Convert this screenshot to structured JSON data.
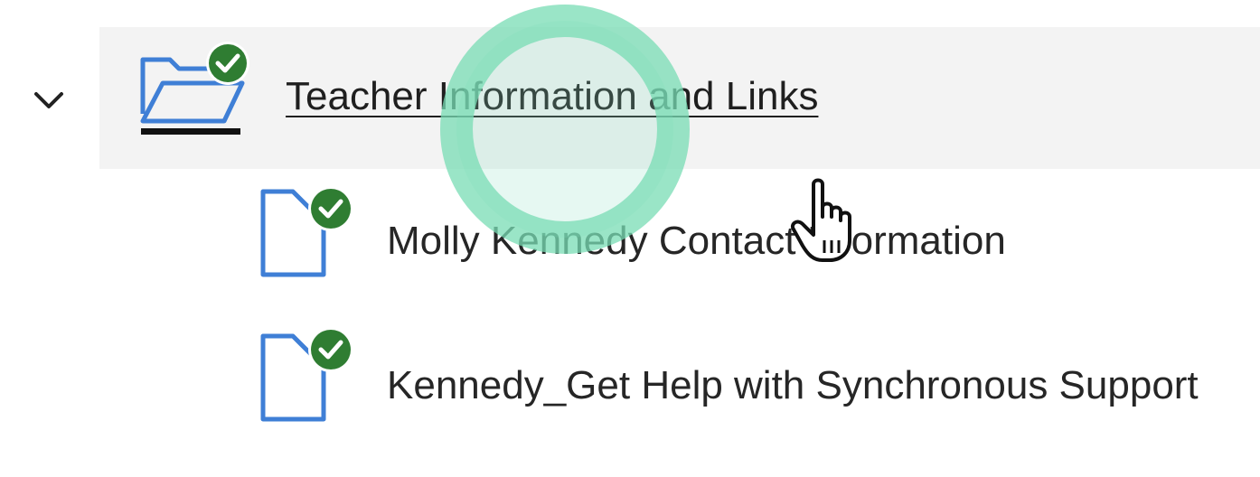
{
  "tree": {
    "folder": {
      "label": "Teacher Information and Links",
      "icon": "folder-open-icon",
      "status": "check-icon",
      "expanded": true
    },
    "items": [
      {
        "label": "Molly Kennedy Contact Information",
        "icon": "document-icon",
        "status": "check-icon"
      },
      {
        "label": "Kennedy_Get Help with Synchronous Support",
        "icon": "document-icon",
        "status": "check-icon"
      }
    ]
  },
  "colors": {
    "icon_blue": "#3f7fd6",
    "check_green": "#2f7d32",
    "row_highlight": "#f3f3f3",
    "click_ring": "#7fdcbc"
  }
}
